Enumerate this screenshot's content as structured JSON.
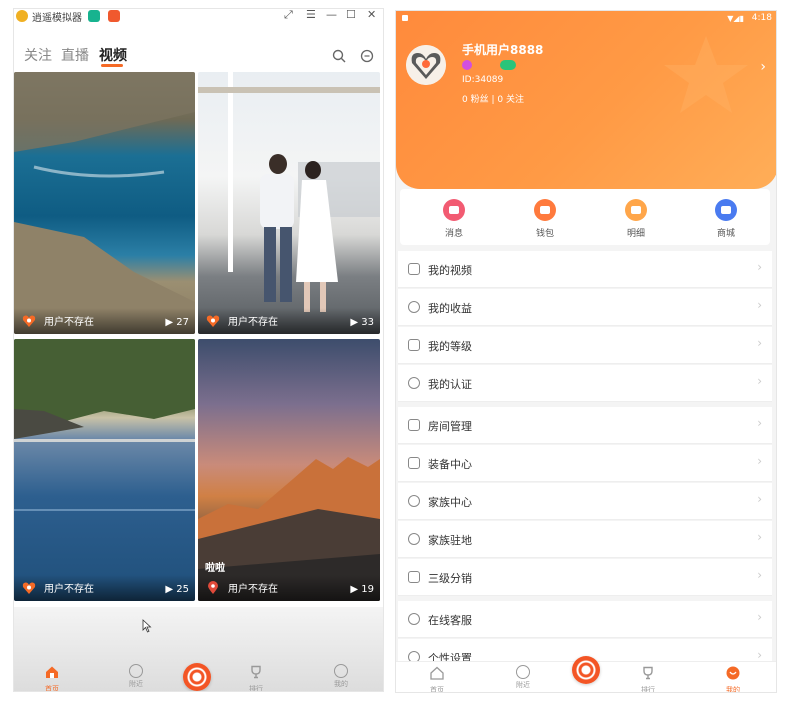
{
  "left": {
    "emulator_title": "逍遥模拟器",
    "window_controls": [
      "⤢",
      "☰",
      "—",
      "☐",
      "✕"
    ],
    "tabs": [
      {
        "label": "关注",
        "active": false
      },
      {
        "label": "直播",
        "active": false
      },
      {
        "label": "视频",
        "active": true
      }
    ],
    "videos": [
      {
        "user": "用户不存在",
        "views": "27",
        "caption": ""
      },
      {
        "user": "用户不存在",
        "views": "33",
        "caption": ""
      },
      {
        "user": "用户不存在",
        "views": "25",
        "caption": ""
      },
      {
        "user": "用户不存在",
        "views": "19",
        "caption": "啦啦"
      }
    ],
    "bottom_nav": [
      {
        "label": "首页",
        "active": true
      },
      {
        "label": "附近",
        "active": false
      },
      {
        "label": "排行",
        "active": false
      },
      {
        "label": "我的",
        "active": false
      }
    ]
  },
  "right": {
    "status": {
      "time": "4:18"
    },
    "profile": {
      "name": "手机用户8888",
      "id": "ID:34089",
      "fans": "0 粉丝",
      "separator": "|",
      "following": "0 关注"
    },
    "quick_actions": [
      {
        "label": "消息",
        "color": "#f25b72"
      },
      {
        "label": "钱包",
        "color": "#ff7a3d"
      },
      {
        "label": "明细",
        "color": "#ffa64a"
      },
      {
        "label": "商城",
        "color": "#4a7bf0"
      }
    ],
    "menu": [
      "我的视频",
      "我的收益",
      "我的等级",
      "我的认证",
      "房间管理",
      "装备中心",
      "家族中心",
      "家族驻地",
      "三级分销",
      "在线客服",
      "个性设置"
    ],
    "bottom_nav": [
      {
        "label": "首页",
        "active": false
      },
      {
        "label": "附近",
        "active": false
      },
      {
        "label": "排行",
        "active": false
      },
      {
        "label": "我的",
        "active": true
      }
    ]
  },
  "colors": {
    "accent": "#f56a26",
    "profile_bg": "#ff9a45"
  }
}
